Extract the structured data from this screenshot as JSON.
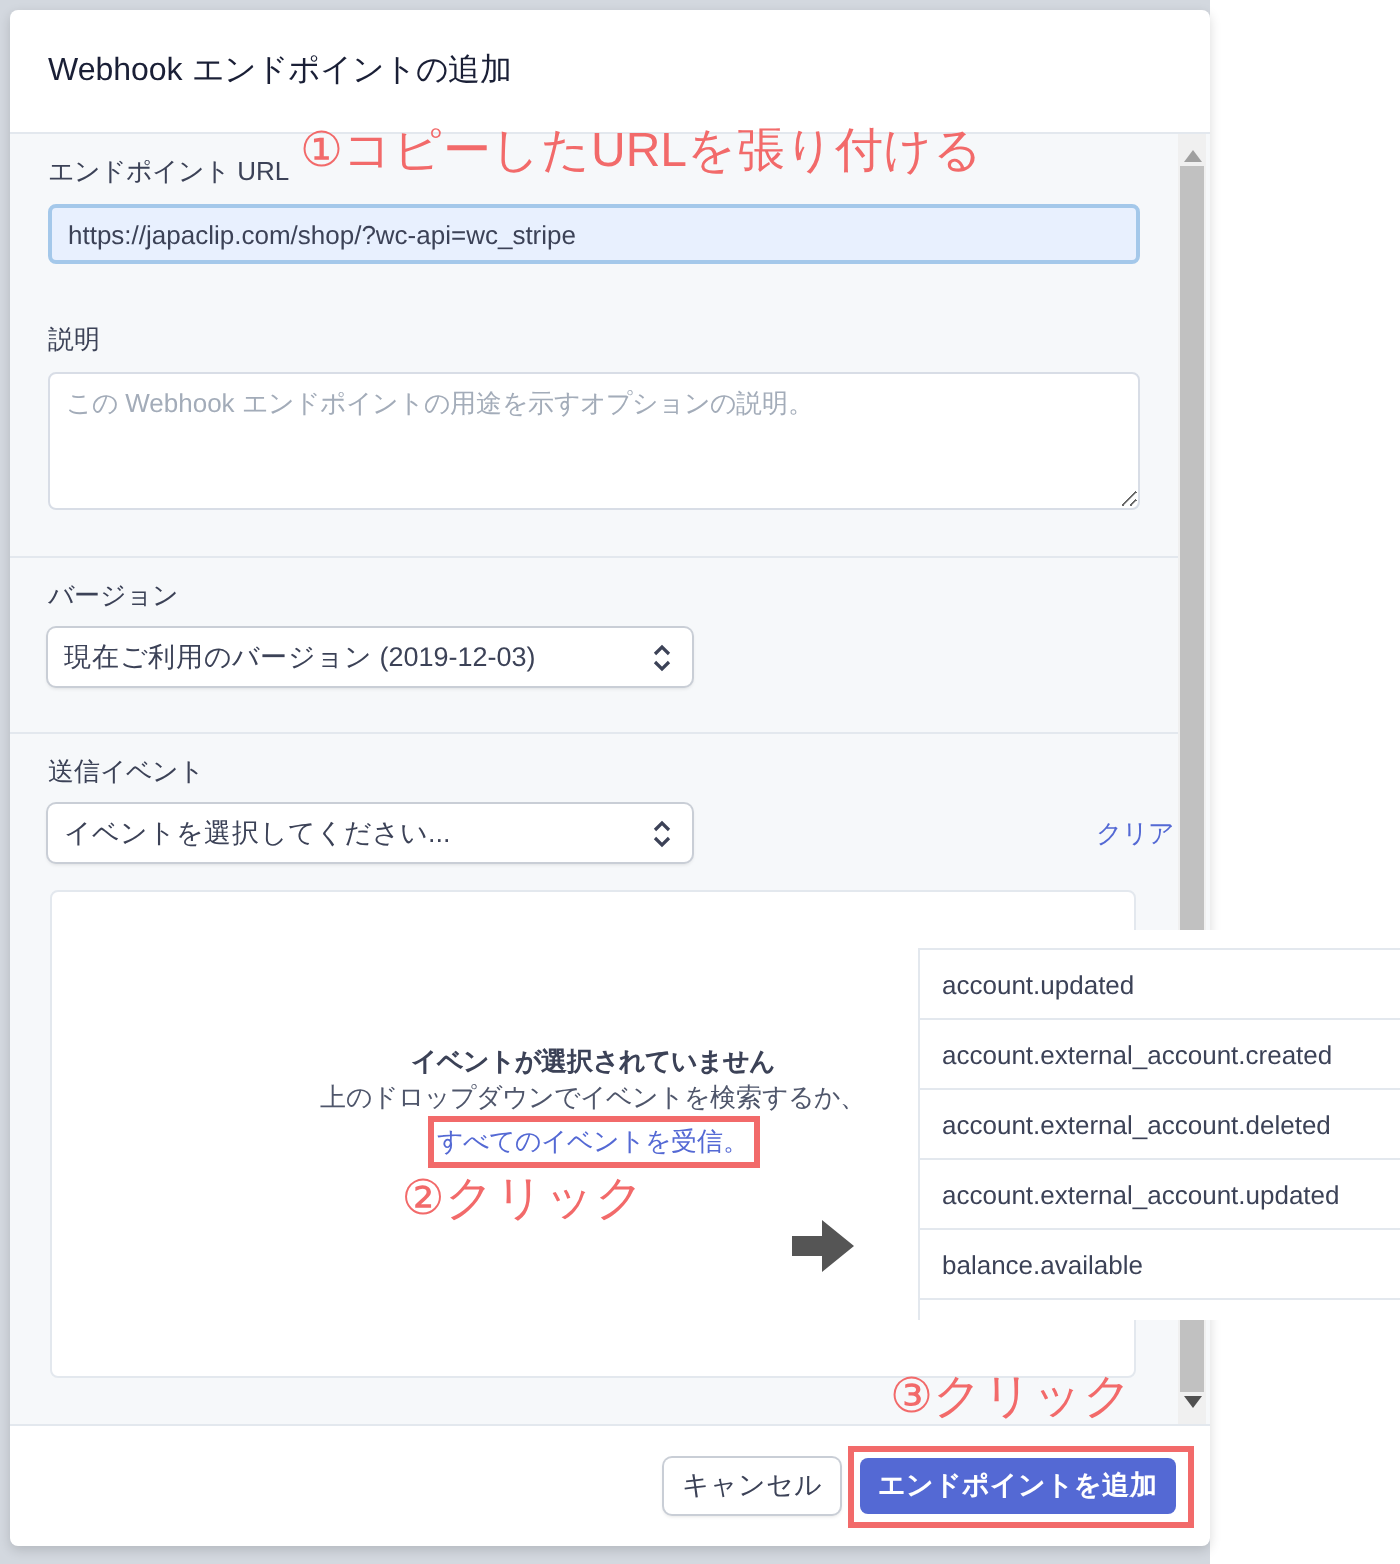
{
  "dialog": {
    "title": "Webhook エンドポイントの追加",
    "fields": [
      {
        "kind": "input",
        "label": "エンドポイント URL",
        "value": "https://japaclip.com/shop/?wc-api=wc_stripe",
        "focused": true
      },
      {
        "kind": "textarea",
        "label": "説明",
        "placeholder": "この Webhook エンドポイントの用途を示すオプションの説明。",
        "focused": false
      },
      {
        "kind": "select",
        "label": "バージョン",
        "value": "現在ご利用のバージョン (2019-12-03)"
      },
      {
        "kind": "select",
        "label": "送信イベント",
        "value": "イベントを選択してください...",
        "action": "クリア"
      }
    ],
    "empty_state": {
      "title": "イベントが選択されていません",
      "text": "上のドロップダウンでイベントを検索するか、",
      "link": "すべてのイベントを受信。"
    },
    "buttons": [
      {
        "label": "キャンセル",
        "primary": false
      },
      {
        "label": "エンドポイントを追加",
        "primary": true
      }
    ]
  },
  "event_list": [
    "account.updated",
    "account.external_account.created",
    "account.external_account.deleted",
    "account.external_account.updated",
    "balance.available"
  ],
  "annotations": [
    {
      "text": "①コピーしたURLを張り付ける"
    },
    {
      "text": "②クリック"
    },
    {
      "text": "③クリック"
    }
  ]
}
